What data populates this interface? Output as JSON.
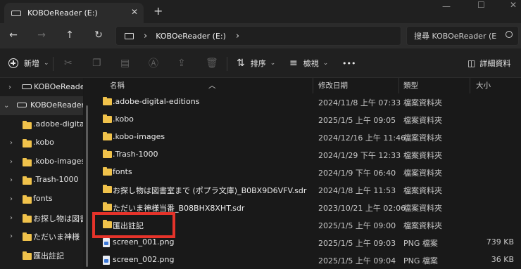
{
  "window": {
    "tab_title": "KOBOeReader (E:)",
    "tab_close": "✕",
    "new_tab": "+",
    "minimize": "—",
    "maximize": "☐",
    "close": "✕"
  },
  "nav": {
    "back": "←",
    "forward": "→",
    "up": "↑",
    "refresh": "↻",
    "separator": "›",
    "breadcrumb": "KOBOeReader (E:)",
    "breadcrumb_expand": "›",
    "search_placeholder": "搜尋 KOBOeReader (E"
  },
  "toolbar": {
    "new_label": "新增",
    "sort_label": "排序",
    "view_label": "檢視",
    "more": "•••",
    "details_label": "詳細資料",
    "icons": [
      "cut-icon",
      "copy-icon",
      "paste-icon",
      "rename-icon",
      "share-icon",
      "delete-icon"
    ]
  },
  "sidebar": {
    "items": [
      {
        "label": "KOBOeReader",
        "icon": "drive-icon",
        "expanded": false,
        "selected": false
      },
      {
        "label": "KOBOeReader (",
        "icon": "drive-icon",
        "expanded": true,
        "selected": true
      },
      {
        "label": ".adobe-digital",
        "icon": "folder-icon"
      },
      {
        "label": ".kobo",
        "icon": "folder-icon"
      },
      {
        "label": ".kobo-images",
        "icon": "folder-icon"
      },
      {
        "label": ".Trash-1000",
        "icon": "folder-icon"
      },
      {
        "label": "fonts",
        "icon": "folder-icon"
      },
      {
        "label": "お探し物は図書",
        "icon": "folder-icon"
      },
      {
        "label": "ただいま神様",
        "icon": "folder-icon"
      },
      {
        "label": "匯出註記",
        "icon": "folder-icon"
      }
    ]
  },
  "columns": {
    "name": "名稱",
    "modified": "修改日期",
    "type": "類型",
    "size": "大小"
  },
  "files": [
    {
      "name": ".adobe-digital-editions",
      "modified": "2024/11/8 上午 07:33",
      "type": "檔案資料夾",
      "size": "",
      "icon": "folder-icon"
    },
    {
      "name": ".kobo",
      "modified": "2025/1/5 上午 09:05",
      "type": "檔案資料夾",
      "size": "",
      "icon": "folder-icon"
    },
    {
      "name": ".kobo-images",
      "modified": "2024/12/16 上午 11:46",
      "type": "檔案資料夾",
      "size": "",
      "icon": "folder-icon"
    },
    {
      "name": ".Trash-1000",
      "modified": "2024/1/29 下午 12:33",
      "type": "檔案資料夾",
      "size": "",
      "icon": "folder-icon"
    },
    {
      "name": "fonts",
      "modified": "2024/1/9 下午 06:40",
      "type": "檔案資料夾",
      "size": "",
      "icon": "folder-icon"
    },
    {
      "name": "お探し物は図書室まで (ポプラ文庫)_B0BX9D6VFV.sdr",
      "modified": "2024/1/8 上午 11:53",
      "type": "檔案資料夾",
      "size": "",
      "icon": "folder-icon"
    },
    {
      "name": "ただいま神様当番_B08BHX8XHT.sdr",
      "modified": "2023/10/21 上午 02:06",
      "type": "檔案資料夾",
      "size": "",
      "icon": "folder-icon"
    },
    {
      "name": "匯出註記",
      "modified": "2025/1/5 上午 09:00",
      "type": "檔案資料夾",
      "size": "",
      "icon": "folder-icon"
    },
    {
      "name": "screen_001.png",
      "modified": "2025/1/5 上午 09:03",
      "type": "PNG 檔案",
      "size": "739 KB",
      "icon": "png-file-icon"
    },
    {
      "name": "screen_002.png",
      "modified": "2025/1/5 上午 09:04",
      "type": "PNG 檔案",
      "size": "36 KB",
      "icon": "png-file-icon"
    }
  ],
  "highlight_color": "#e5332a",
  "folder_color": "#f0c24b"
}
